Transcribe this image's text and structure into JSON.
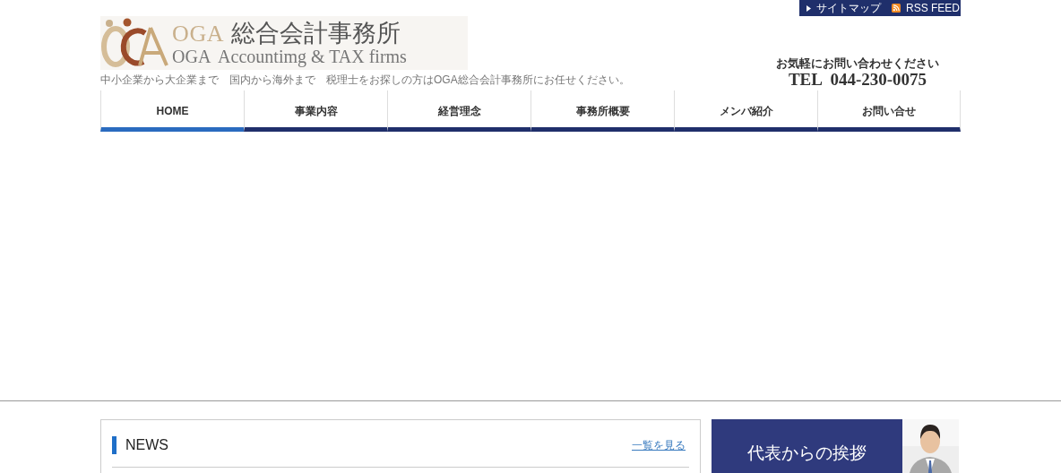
{
  "top_links": [
    {
      "kind": "sitemap",
      "label": "サイトマップ"
    },
    {
      "kind": "rss",
      "label": "RSS FEED"
    }
  ],
  "logo": {
    "mark": "OGA",
    "name": "総合会計事務所",
    "subtitle": "OGA  Accountimg & TAX firms"
  },
  "tagline": "中小企業から大企業まで　国内から海外まで　税理士をお探しの方はOGA総合会計事務所にお任せください。",
  "contact": {
    "lead": "お気軽にお問い合わせください",
    "phone": "TEL  044-230-0075"
  },
  "nav": [
    {
      "label": "HOME",
      "selected": true
    },
    {
      "label": "事業内容",
      "selected": false
    },
    {
      "label": "経営理念",
      "selected": false
    },
    {
      "label": "事務所概要",
      "selected": false
    },
    {
      "label": "メンバ紹介",
      "selected": false
    },
    {
      "label": "お問い合せ",
      "selected": false
    }
  ],
  "news": {
    "title": "NEWS",
    "more": "一覧を見る"
  },
  "greeting_banner": {
    "label": "代表からの挨拶"
  }
}
